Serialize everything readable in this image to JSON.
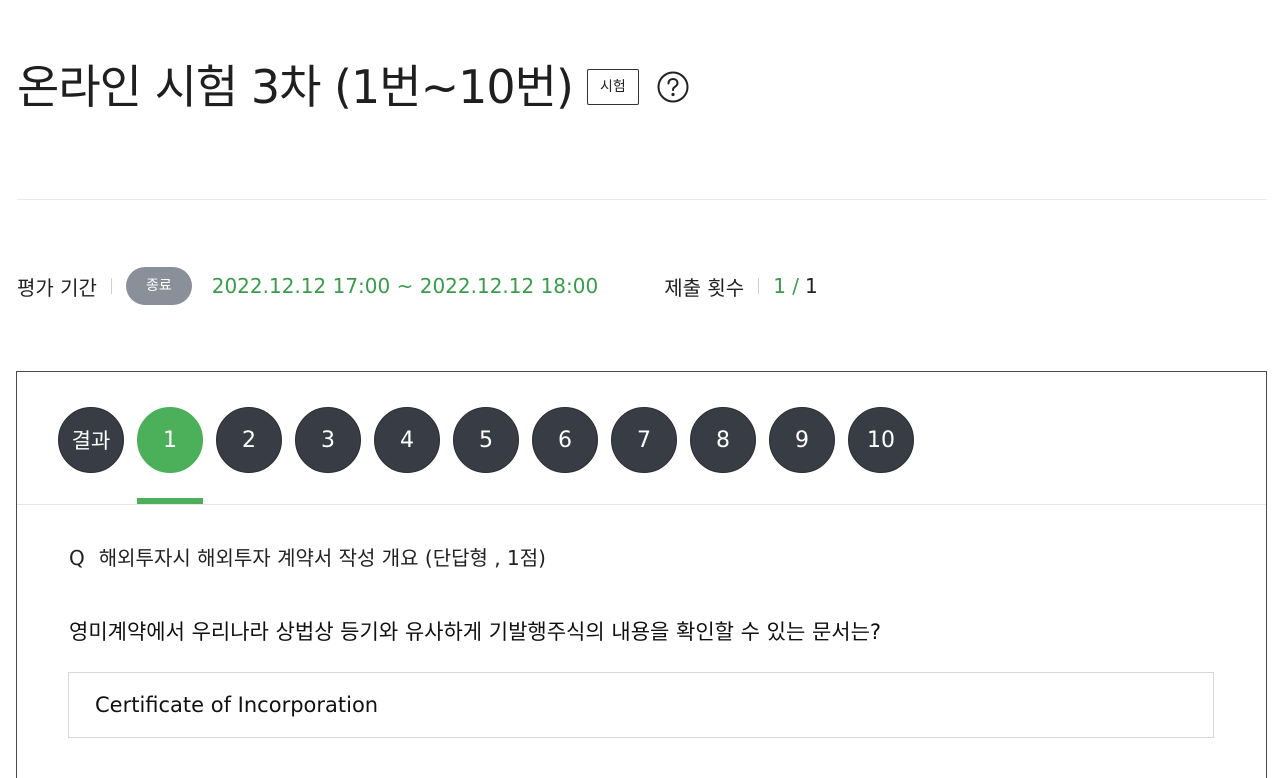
{
  "header": {
    "title": "온라인 시험 3차 (1번~10번)",
    "type_badge": "시험",
    "help_icon": "question-circle-icon"
  },
  "info": {
    "period_label": "평가 기간",
    "status": "종료",
    "period_value": "2022.12.12 17:00 ~ 2022.12.12 18:00",
    "submit_label": "제출 횟수",
    "submit_current": "1 /",
    "submit_total": "1"
  },
  "tabs": [
    "결과",
    "1",
    "2",
    "3",
    "4",
    "5",
    "6",
    "7",
    "8",
    "9",
    "10"
  ],
  "active_tab": "1",
  "question": {
    "prefix": "Q",
    "title": "해외투자시 해외투자 계약서 작성 개요 (단답형 , 1점)",
    "body": "영미계약에서 우리나라 상법상 등기와 유사하게 기발행주식의 내용을 확인할 수 있는 문서는?",
    "answer": "Certificate of Incorporation"
  },
  "colors": {
    "accent": "#4caf5a",
    "tab_bg": "#383d45",
    "status_badge": "#8a9099",
    "period_text": "#3a9b4a"
  }
}
